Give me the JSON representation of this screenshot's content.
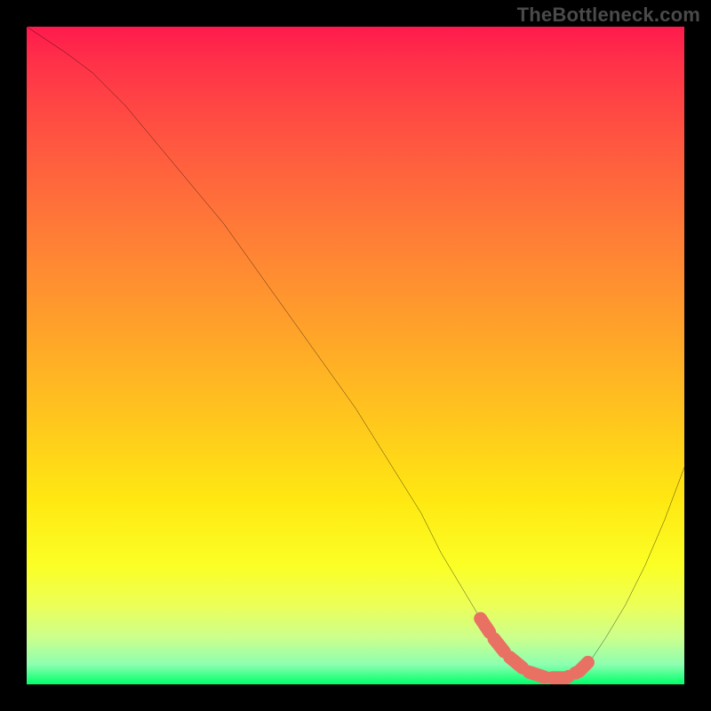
{
  "watermark_text": "TheBottleneck.com",
  "chart_data": {
    "type": "line",
    "title": "",
    "xlabel": "",
    "ylabel": "",
    "xlim": [
      0,
      100
    ],
    "ylim": [
      0,
      100
    ],
    "grid": false,
    "legend": false,
    "background": {
      "type": "vertical-gradient",
      "description": "Red (top / high bottleneck) through orange, yellow, to green (bottom / no bottleneck)"
    },
    "series": [
      {
        "name": "bottleneck-main-curve",
        "description": "Black V-shaped curve; bottleneck percentage vs. optimum region",
        "color": "#000000",
        "x": [
          0,
          3,
          6,
          10,
          15,
          20,
          25,
          30,
          35,
          40,
          45,
          50,
          55,
          60,
          63,
          66,
          69,
          71,
          73,
          76,
          79,
          82,
          84,
          86,
          88,
          91,
          94,
          97,
          100
        ],
        "values": [
          100,
          98,
          96,
          93,
          88,
          82,
          76,
          70,
          63,
          56,
          49,
          42,
          34,
          26,
          20,
          15,
          10,
          7,
          4.5,
          2,
          1,
          1,
          2,
          4,
          7,
          12,
          18,
          25,
          33
        ]
      },
      {
        "name": "optimum-band-highlight",
        "description": "Thick semi-transparent coral overlay along valley floor marking optimal range",
        "color": "#e97164",
        "thickness": 14,
        "x": [
          69,
          71,
          73,
          76,
          79,
          82,
          84,
          86
        ],
        "values": [
          10,
          7,
          4.5,
          2,
          1,
          1,
          2,
          4
        ]
      }
    ]
  }
}
